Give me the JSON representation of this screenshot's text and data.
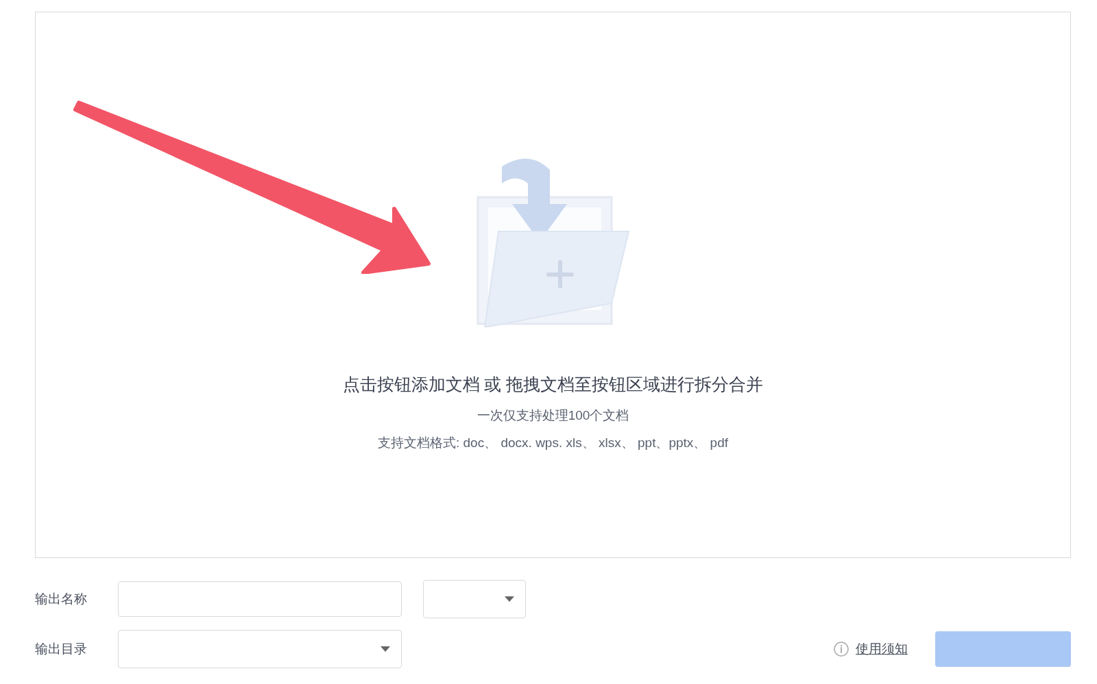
{
  "upload_area": {
    "title": "点击按钮添加文档 或 拖拽文档至按钮区域进行拆分合并",
    "limit_note": "一次仅支持处理100个文档",
    "formats_note": "支持文档格式: doc、 docx. wps. xls、 xlsx、 ppt、pptx、 pdf"
  },
  "output_name": {
    "label": "输出名称"
  },
  "output_directory": {
    "label": "输出目录"
  },
  "usage_link": "使用须知"
}
